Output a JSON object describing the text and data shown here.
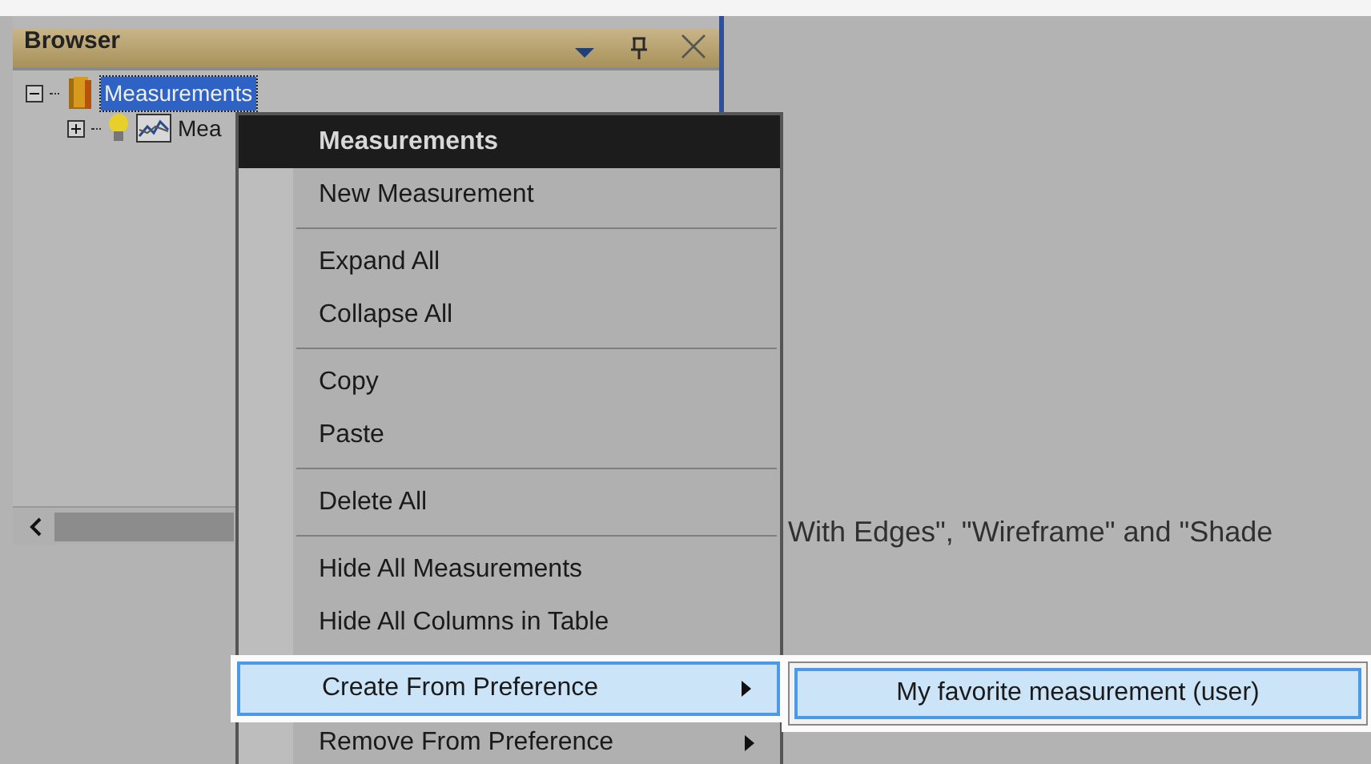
{
  "panel": {
    "title": "Browser",
    "tree": [
      {
        "label": "Measurements",
        "expanded": true,
        "selected": true,
        "kind": "folder",
        "children": [
          {
            "label": "Mea",
            "expanded": false,
            "selected": false,
            "kind": "measurement"
          }
        ]
      }
    ]
  },
  "background_text": "With Edges\", \"Wireframe\" and \"Shade",
  "context_menu": {
    "header": "Measurements",
    "groups": [
      [
        {
          "label": "New Measurement",
          "selected": false,
          "has_submenu": false
        }
      ],
      [
        {
          "label": "Expand All",
          "selected": false,
          "has_submenu": false
        },
        {
          "label": "Collapse All",
          "selected": false,
          "has_submenu": false
        }
      ],
      [
        {
          "label": "Copy",
          "selected": false,
          "has_submenu": false
        },
        {
          "label": "Paste",
          "selected": false,
          "has_submenu": false
        }
      ],
      [
        {
          "label": "Delete All",
          "selected": false,
          "has_submenu": false
        }
      ],
      [
        {
          "label": "Hide All Measurements",
          "selected": false,
          "has_submenu": false
        },
        {
          "label": "Hide All Columns in Table",
          "selected": false,
          "has_submenu": false
        },
        {
          "label": "Create From Preference",
          "selected": true,
          "has_submenu": true
        },
        {
          "label": "Remove From Preference",
          "selected": false,
          "has_submenu": true
        }
      ]
    ]
  },
  "submenu": {
    "items": [
      {
        "label": "My favorite measurement (user)",
        "selected": true
      }
    ]
  }
}
